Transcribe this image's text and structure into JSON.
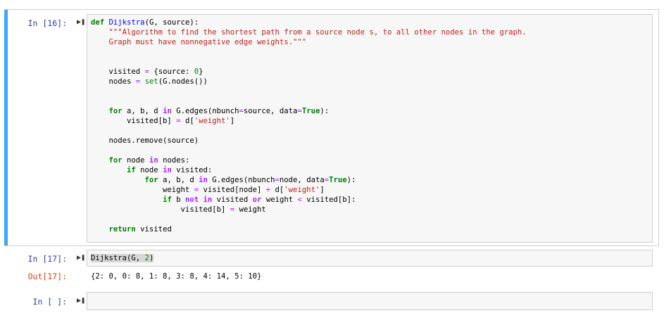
{
  "cells": [
    {
      "prompt": "In [16]:",
      "lines": [
        [
          {
            "t": "def",
            "c": "kw"
          },
          {
            "t": " "
          },
          {
            "t": "Dijkstra",
            "c": "fn"
          },
          {
            "t": "(G, source):"
          }
        ],
        [
          {
            "t": "    "
          },
          {
            "t": "\"\"\"Algorithm to find the shortest path from a source node s, to all other nodes in the graph.",
            "c": "str"
          }
        ],
        [
          {
            "t": "    "
          },
          {
            "t": "Graph must have nonnegative edge weights.\"\"\"",
            "c": "str"
          }
        ],
        [
          {
            "t": ""
          }
        ],
        [
          {
            "t": ""
          }
        ],
        [
          {
            "t": "    visited "
          },
          {
            "t": "=",
            "c": "op"
          },
          {
            "t": " {source: "
          },
          {
            "t": "0",
            "c": "num"
          },
          {
            "t": "}"
          }
        ],
        [
          {
            "t": "    nodes "
          },
          {
            "t": "=",
            "c": "op"
          },
          {
            "t": " "
          },
          {
            "t": "set",
            "c": "bi"
          },
          {
            "t": "(G.nodes())"
          }
        ],
        [
          {
            "t": ""
          }
        ],
        [
          {
            "t": ""
          }
        ],
        [
          {
            "t": "    "
          },
          {
            "t": "for",
            "c": "kw"
          },
          {
            "t": " a, b, d "
          },
          {
            "t": "in",
            "c": "kw2"
          },
          {
            "t": " G.edges(nbunch"
          },
          {
            "t": "=",
            "c": "op"
          },
          {
            "t": "source, data"
          },
          {
            "t": "=",
            "c": "op"
          },
          {
            "t": "True",
            "c": "kw"
          },
          {
            "t": "):"
          }
        ],
        [
          {
            "t": "        visited[b] "
          },
          {
            "t": "=",
            "c": "op"
          },
          {
            "t": " d["
          },
          {
            "t": "'weight'",
            "c": "str"
          },
          {
            "t": "]"
          }
        ],
        [
          {
            "t": ""
          }
        ],
        [
          {
            "t": "    nodes.remove(source)"
          }
        ],
        [
          {
            "t": ""
          }
        ],
        [
          {
            "t": "    "
          },
          {
            "t": "for",
            "c": "kw"
          },
          {
            "t": " node "
          },
          {
            "t": "in",
            "c": "kw2"
          },
          {
            "t": " nodes:"
          }
        ],
        [
          {
            "t": "        "
          },
          {
            "t": "if",
            "c": "kw"
          },
          {
            "t": " node "
          },
          {
            "t": "in",
            "c": "kw2"
          },
          {
            "t": " visited:"
          }
        ],
        [
          {
            "t": "            "
          },
          {
            "t": "for",
            "c": "kw"
          },
          {
            "t": " a, b, d "
          },
          {
            "t": "in",
            "c": "kw2"
          },
          {
            "t": " G.edges(nbunch"
          },
          {
            "t": "=",
            "c": "op"
          },
          {
            "t": "node, data"
          },
          {
            "t": "=",
            "c": "op"
          },
          {
            "t": "True",
            "c": "kw"
          },
          {
            "t": "):"
          }
        ],
        [
          {
            "t": "                weight "
          },
          {
            "t": "=",
            "c": "op"
          },
          {
            "t": " visited[node] "
          },
          {
            "t": "+",
            "c": "op"
          },
          {
            "t": " d["
          },
          {
            "t": "'weight'",
            "c": "str"
          },
          {
            "t": "]"
          }
        ],
        [
          {
            "t": "                "
          },
          {
            "t": "if",
            "c": "kw"
          },
          {
            "t": " b "
          },
          {
            "t": "not",
            "c": "kw2"
          },
          {
            "t": " "
          },
          {
            "t": "in",
            "c": "kw2"
          },
          {
            "t": " visited "
          },
          {
            "t": "or",
            "c": "kw2"
          },
          {
            "t": " weight "
          },
          {
            "t": "<",
            "c": "op"
          },
          {
            "t": " visited[b]:"
          }
        ],
        [
          {
            "t": "                    visited[b] "
          },
          {
            "t": "=",
            "c": "op"
          },
          {
            "t": " weight"
          }
        ],
        [
          {
            "t": ""
          }
        ],
        [
          {
            "t": "    "
          },
          {
            "t": "return",
            "c": "kw"
          },
          {
            "t": " visited"
          }
        ]
      ]
    },
    {
      "prompt": "In [17]:",
      "lines": [
        [
          {
            "t": "Dijkstra(G, ",
            "c": "hl"
          },
          {
            "t": "2",
            "c": "num hl"
          },
          {
            "t": ")",
            "c": "hl"
          }
        ]
      ],
      "output_prompt": "Out[17]:",
      "output": "{2: 0, 0: 8, 1: 8, 3: 8, 4: 14, 5: 10}"
    },
    {
      "prompt": "In [ ]:",
      "lines": []
    }
  ]
}
